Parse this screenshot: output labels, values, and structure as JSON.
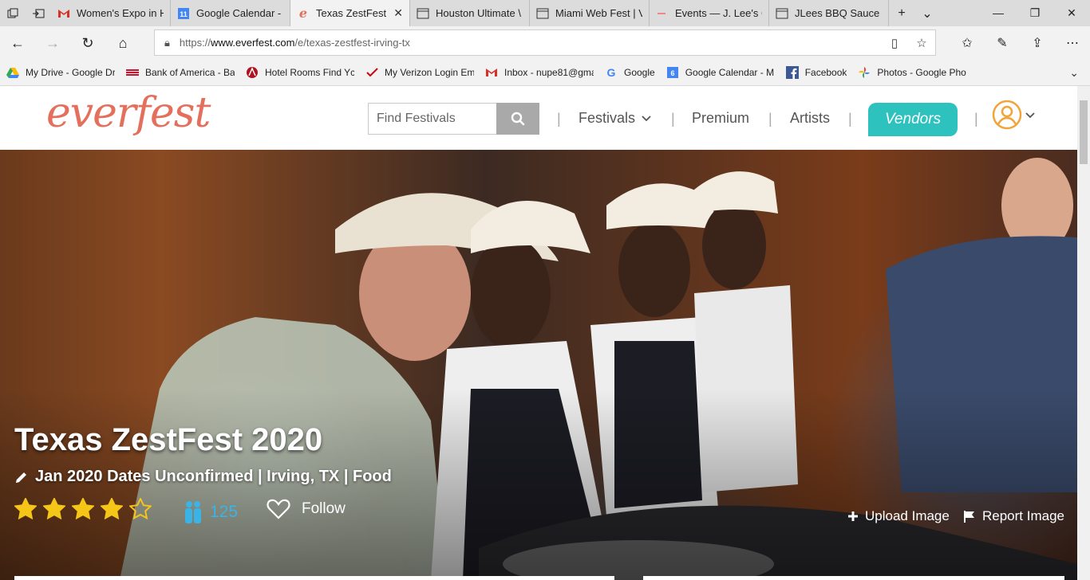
{
  "browser": {
    "tabs": [
      {
        "title": "Women's Expo in H",
        "icon": "gmail-icon",
        "active": false
      },
      {
        "title": "Google Calendar -",
        "icon": "calendar-icon",
        "active": false
      },
      {
        "title": "Texas ZestFest",
        "icon": "everfest-icon",
        "active": true
      },
      {
        "title": "Houston Ultimate \\",
        "icon": "page-icon",
        "active": false
      },
      {
        "title": "Miami Web Fest | V",
        "icon": "page-icon",
        "active": false
      },
      {
        "title": "Events — J. Lee's G",
        "icon": "dash-icon",
        "active": false
      },
      {
        "title": "JLees BBQ Sauce -",
        "icon": "page-icon",
        "active": false
      }
    ],
    "url_prefix": "https://",
    "url_host": "www.everfest.com",
    "url_path": "/e/texas-zestfest-irving-tx",
    "favorites": [
      {
        "label": "My Drive - Google Dr",
        "icon": "drive-icon"
      },
      {
        "label": "Bank of America - Bai",
        "icon": "bofa-icon"
      },
      {
        "label": "Hotel Rooms  Find Yc",
        "icon": "hotel-icon"
      },
      {
        "label": "My Verizon  Login Em",
        "icon": "verizon-icon"
      },
      {
        "label": "Inbox - nupe81@gma",
        "icon": "gmail-icon"
      },
      {
        "label": "Google",
        "icon": "google-icon"
      },
      {
        "label": "Google Calendar - M",
        "icon": "calendar-icon"
      },
      {
        "label": "Facebook",
        "icon": "facebook-icon"
      },
      {
        "label": "Photos - Google Phot",
        "icon": "photos-icon"
      }
    ]
  },
  "header": {
    "logo": "everfest",
    "search_placeholder": "Find Festivals",
    "nav": {
      "festivals": "Festivals",
      "premium": "Premium",
      "artists": "Artists",
      "vendors": "Vendors"
    }
  },
  "festival": {
    "title": "Texas ZestFest 2020",
    "meta": "Jan 2020 Dates Unconfirmed | Irving, TX | Food",
    "rating": 4,
    "rating_max": 5,
    "attendees": "125",
    "follow_label": "Follow",
    "upload_label": "Upload Image",
    "report_label": "Report Image"
  },
  "colors": {
    "brand": "#e46f5c",
    "vendors": "#2ec2bf",
    "star": "#f5c518",
    "attendee": "#3ab4e6"
  }
}
